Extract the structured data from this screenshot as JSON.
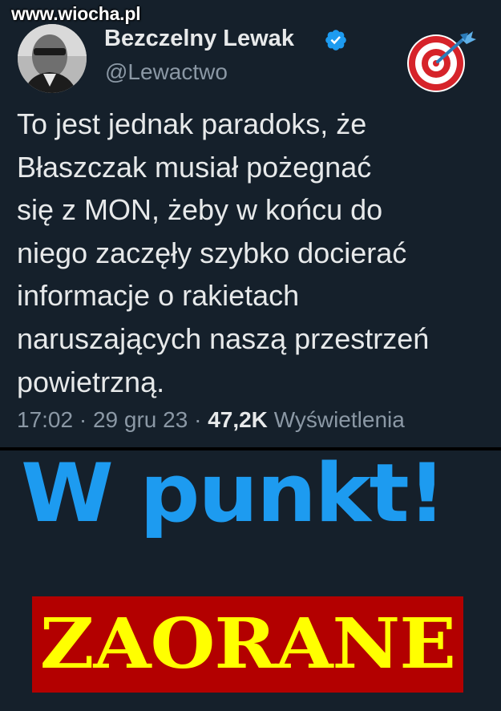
{
  "watermark": {
    "text": "www.wiocha.pl"
  },
  "tweet": {
    "author_name": "Bezczelny Lewak",
    "author_handle": "@Lewactwo",
    "verified_icon": "verified-badge-icon",
    "avatar_icon": "avatar",
    "decoration_icon": "target-dart-icon",
    "text_lines": [
      "To jest jednak paradoks, że",
      "Błaszczak musiał pożegnać",
      "się z MON, żeby w końcu do",
      "niego zaczęły szybko docierać",
      "informacje o rakietach",
      "naruszających naszą przestrzeń",
      "powietrzną."
    ],
    "time": "17:02",
    "separator": "·",
    "date": "29 gru 23",
    "views_count": "47,2K",
    "views_label": "Wyświetlenia"
  },
  "caption": {
    "headline": "W punkt!",
    "banner": "ZAORANE"
  },
  "colors": {
    "background": "#15202b",
    "accent_blue": "#1d9bf0",
    "banner_red": "#b30000",
    "banner_yellow": "#ffff00"
  }
}
